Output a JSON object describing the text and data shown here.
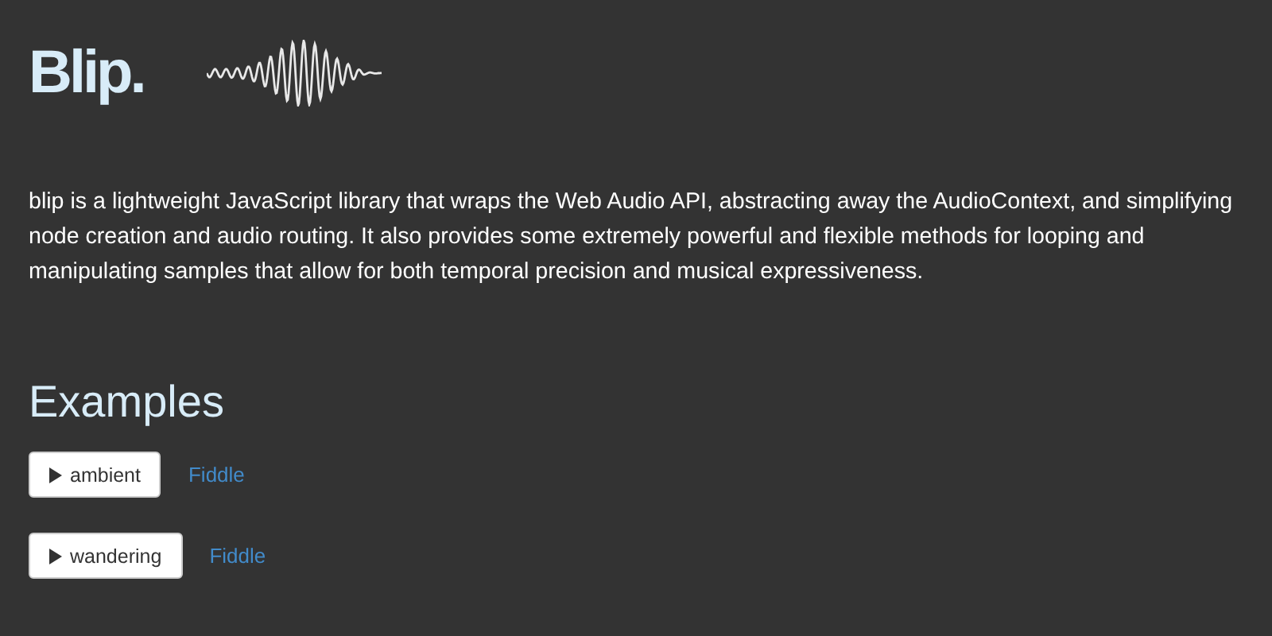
{
  "title": "Blip.",
  "description": "blip is a lightweight JavaScript library that wraps the Web Audio API, abstracting away the AudioContext, and simplifying node creation and audio routing. It also provides some extremely powerful and flexible methods for looping and manipulating samples that allow for both temporal precision and musical expressiveness.",
  "examples": {
    "heading": "Examples",
    "items": [
      {
        "label": "ambient",
        "link": "Fiddle"
      },
      {
        "label": "wandering",
        "link": "Fiddle"
      }
    ]
  }
}
